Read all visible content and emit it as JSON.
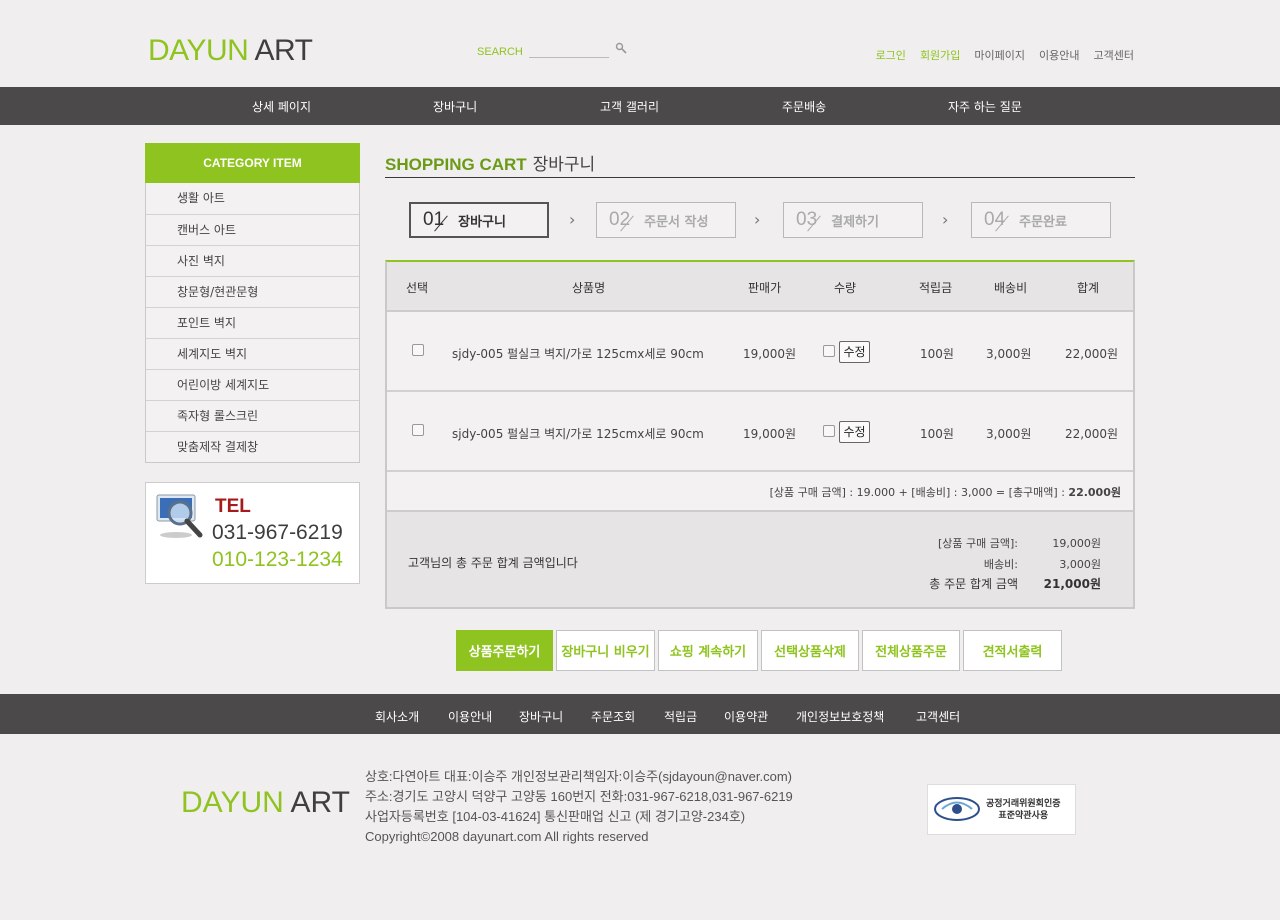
{
  "header": {
    "logo_green": "DAYUN",
    "logo_dark": "ART",
    "search_label": "SEARCH",
    "links": [
      "로그인",
      "회원가입",
      "마이페이지",
      "이용안내",
      "고객센터"
    ]
  },
  "gnb": [
    "상세 페이지",
    "장바구니",
    "고객 갤러리",
    "주문배송",
    "자주 하는 질문"
  ],
  "sidebar": {
    "heading": "CATEGORY ITEM",
    "items": [
      "생활 아트",
      "캔버스 아트",
      "사진 벽지",
      "창문형/현관문형",
      "포인트 벽지",
      "세계지도 벽지",
      "어린이방 세계지도",
      "족자형 롤스크린",
      "맞춤제작 결제창"
    ],
    "tel_title": "TEL",
    "tel_1": "031-967-6219",
    "tel_2": "010-123-1234"
  },
  "page": {
    "title_en": "SHOPPING CART",
    "title_ko": "장바구니",
    "steps": [
      {
        "num": "01",
        "label": "장바구니"
      },
      {
        "num": "02",
        "label": "주문서 작성"
      },
      {
        "num": "03",
        "label": "결제하기"
      },
      {
        "num": "04",
        "label": "주문완료"
      }
    ],
    "arrow": "›"
  },
  "cart": {
    "headers": [
      "선택",
      "상품명",
      "판매가",
      "수량",
      "적립금",
      "배송비",
      "합계"
    ],
    "rows": [
      {
        "name": "sjdy-005 펄실크 벽지/가로 125cmx세로 90cm",
        "price": "19,000원",
        "edit": "수정",
        "points": "100원",
        "shipping": "3,000원",
        "total": "22,000원"
      },
      {
        "name": "sjdy-005 펄실크 벽지/가로 125cmx세로 90cm",
        "price": "19,000원",
        "edit": "수정",
        "points": "100원",
        "shipping": "3,000원",
        "total": "22,000원"
      }
    ],
    "summary_text": "[상품 구매 금액] : 19.000 + [배송비] : 3,000 = [총구매액] : ",
    "summary_total": "22.000원",
    "total_message": "고객님의 총 주문 합계 금액입니다",
    "total_lines": [
      {
        "label": "[상품 구매 금액]:",
        "value": "19,000원"
      },
      {
        "label": "배송비:",
        "value": "3,000원"
      },
      {
        "label": "총 주문 합계 금액",
        "value": "21,000원"
      }
    ]
  },
  "actions": [
    "상품주문하기",
    "장바구니 비우기",
    "쇼핑 계속하기",
    "선택상품삭제",
    "전체상품주문",
    "견적서출력"
  ],
  "footer": {
    "links": [
      "회사소개",
      "이용안내",
      "장바구니",
      "주문조회",
      "적립금",
      "이용약관",
      "개인정보보호정책",
      "고객센터"
    ],
    "logo_green": "DAYUN",
    "logo_dark": "ART",
    "info": [
      "상호:다연아트  대표:이승주  개인정보관리책임자:이승주(sjdayoun@naver.com)",
      "주소:경기도 고양시 덕양구 고양동 160번지 전화:031-967-6218,031-967-6219",
      "사업자등록번호 [104-03-41624] 통신판매업 신고 (제 경기고양-234호)",
      "Copyright©2008 dayunart.com All rights reserved"
    ],
    "badge_line1": "공정거래위원회인증",
    "badge_line2": "표준약관사용"
  },
  "colors": {
    "accent": "#8fc31f",
    "nav_bg": "#4b4949",
    "page_bg": "#f0eeef"
  }
}
